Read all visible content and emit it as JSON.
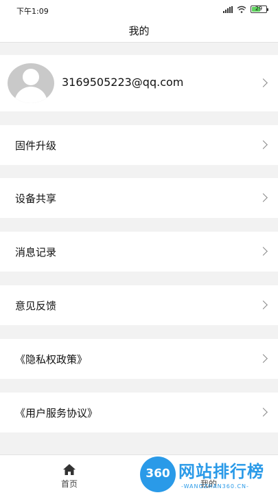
{
  "status_bar": {
    "time": "下午1:09",
    "battery": "29"
  },
  "nav": {
    "title": "我的"
  },
  "profile": {
    "email": "3169505223@qq.com"
  },
  "menu": [
    {
      "label": "固件升级"
    },
    {
      "label": "设备共享"
    },
    {
      "label": "消息记录"
    },
    {
      "label": "意见反馈"
    },
    {
      "label": "《隐私权政策》"
    },
    {
      "label": "《用户服务协议》"
    }
  ],
  "tabs": [
    {
      "label": "首页",
      "icon": "home-icon"
    },
    {
      "label": "我的"
    }
  ],
  "watermark": {
    "badge": "360",
    "title": "网站排行榜",
    "subtitle": "-WANGZHAN360.CN-"
  },
  "colors": {
    "accent": "#2a9ae8",
    "battery": "#5fd35f",
    "background": "#f2f2f2"
  }
}
